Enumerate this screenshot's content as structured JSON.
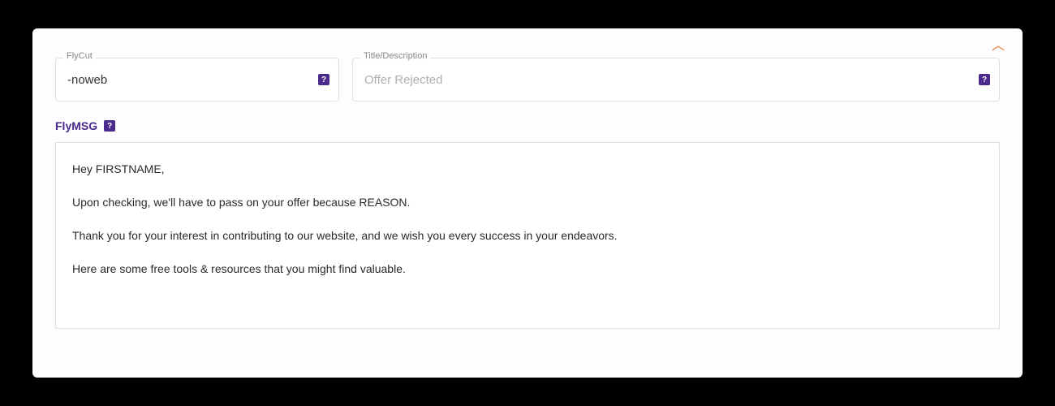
{
  "collapse_icon": "︿",
  "flycut": {
    "label": "FlyCut",
    "value": "-noweb",
    "help": "?"
  },
  "title": {
    "label": "Title/Description",
    "placeholder": "Offer Rejected",
    "help": "?"
  },
  "flymsg": {
    "label": "FlyMSG",
    "help": "?",
    "paragraphs": [
      "Hey FIRSTNAME,",
      "Upon checking, we'll have to pass on your offer because REASON.",
      "Thank you for your interest in contributing to our website, and we wish you every success in your endeavors.",
      "Here are some free tools & resources that you might find valuable."
    ]
  }
}
